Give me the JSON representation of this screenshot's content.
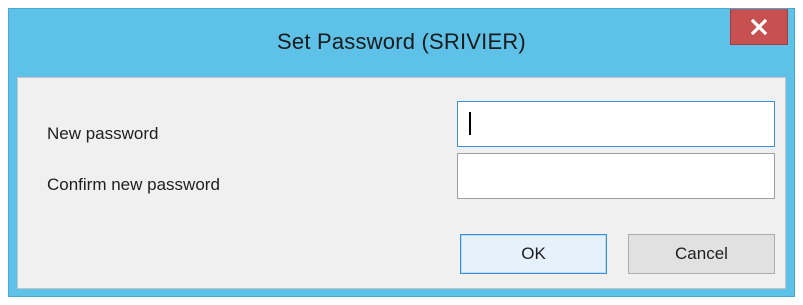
{
  "window": {
    "title": "Set Password (SRIVIER)"
  },
  "titlebar": {
    "close_icon": "close-x-icon"
  },
  "form": {
    "new_password_label": "New password",
    "new_password_value": "",
    "confirm_password_label": "Confirm new password",
    "confirm_password_value": ""
  },
  "buttons": {
    "ok_label": "OK",
    "cancel_label": "Cancel"
  },
  "colors": {
    "titlebar": "#5dc1e8",
    "close_button": "#c75050",
    "focus_border": "#3c8fd6",
    "client_background": "#f0f0f0"
  }
}
